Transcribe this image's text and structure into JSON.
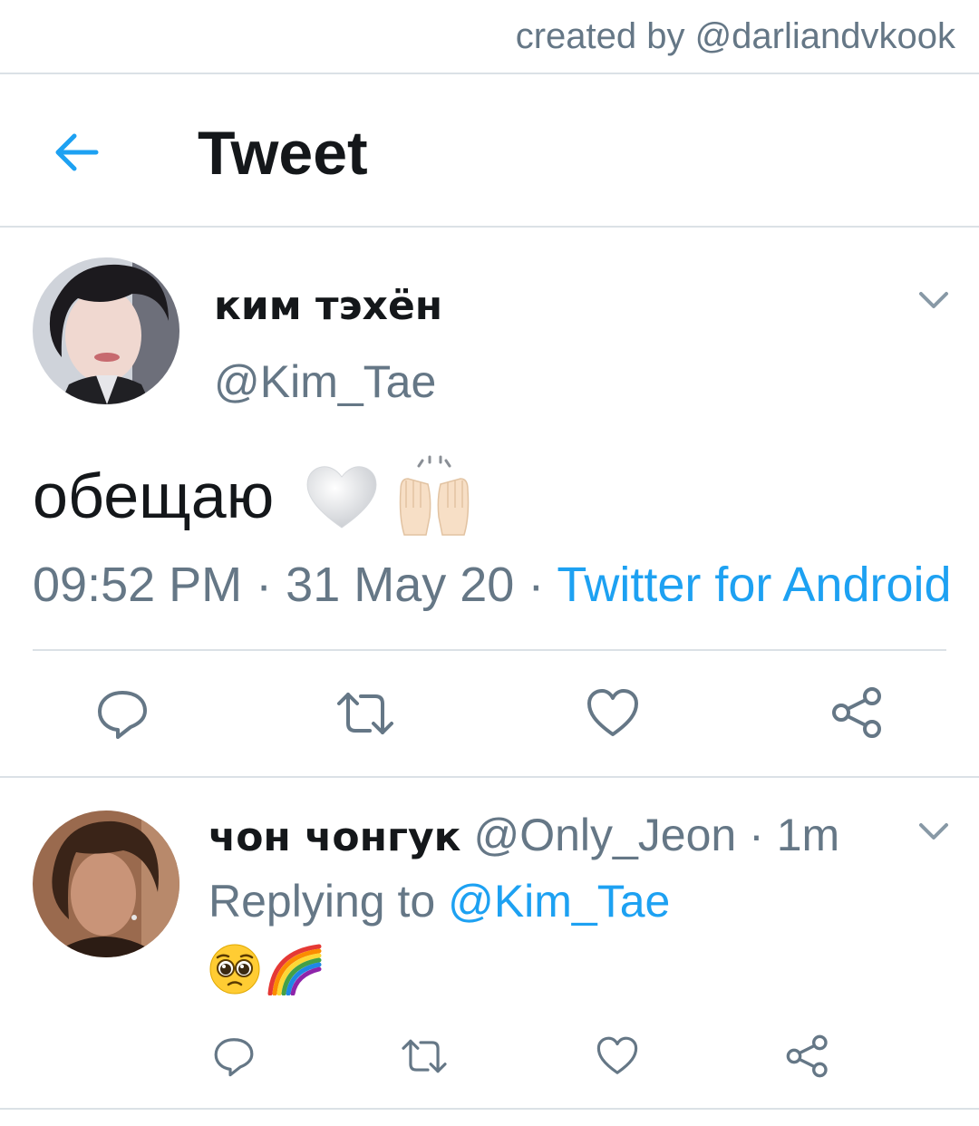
{
  "watermark": "created by @darliandvkook",
  "header": {
    "title": "Tweet",
    "back_icon": "arrow-left-icon",
    "accent": "#1da1f2"
  },
  "tweet": {
    "author_name": "ким тэхён",
    "author_handle": "@Kim_Tae",
    "text": "обещаю",
    "emojis": [
      "white-heart-icon",
      "raising-hands-icon"
    ],
    "time": "09:52 PM",
    "date": "31 May 20",
    "separator": "·",
    "source": "Twitter for Android",
    "actions": [
      "reply-icon",
      "retweet-icon",
      "like-icon",
      "share-icon"
    ]
  },
  "reply": {
    "author_name": "чон чонгук",
    "author_handle": "@Only_Jeon",
    "separator": "·",
    "time": "1m",
    "replying_to_label": "Replying to",
    "replying_to_handle": "@Kim_Tae",
    "emojis": [
      "pleading-face-icon",
      "rainbow-icon"
    ],
    "actions": [
      "reply-icon",
      "retweet-icon",
      "like-icon",
      "share-icon"
    ]
  },
  "colors": {
    "text": "#14171a",
    "secondary": "#657786",
    "link": "#1da1f2",
    "divider": "#dbe1e6"
  }
}
